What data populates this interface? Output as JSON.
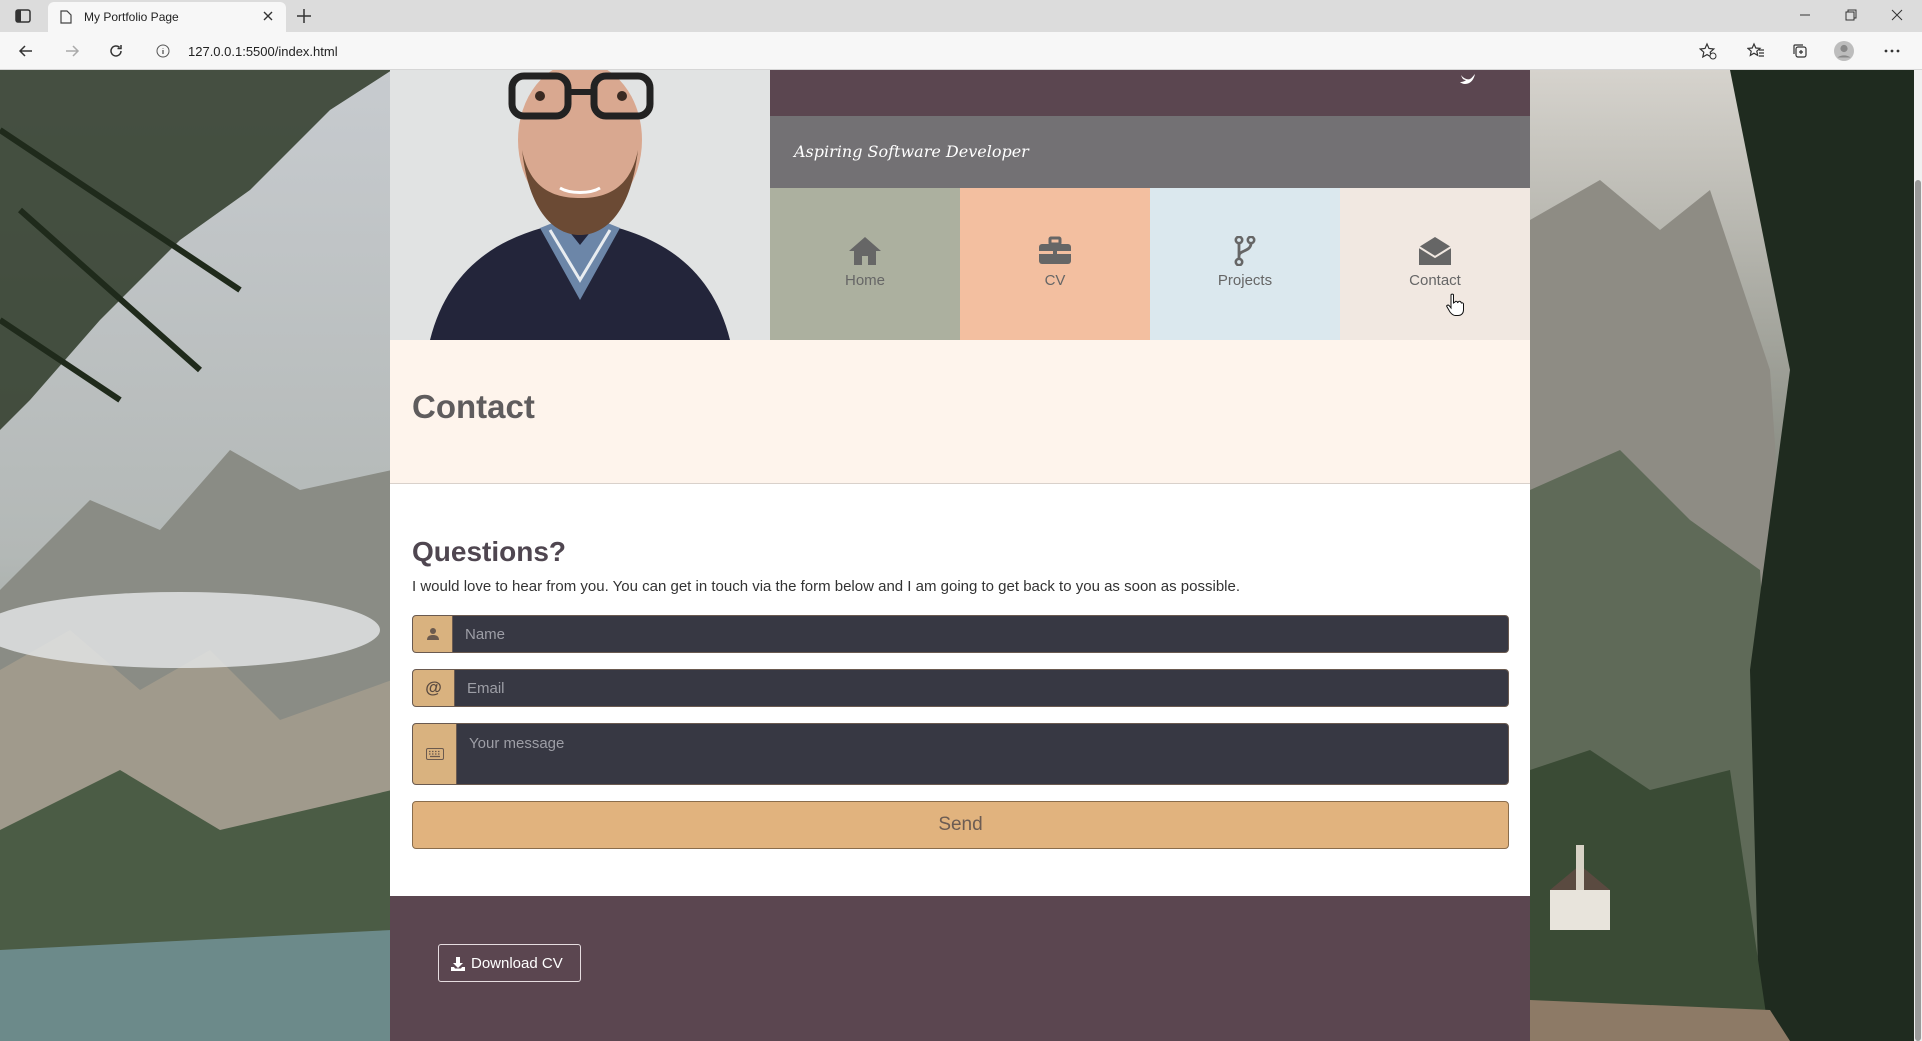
{
  "browser": {
    "tab_title": "My Portfolio Page",
    "url": "127.0.0.1:5500/index.html"
  },
  "hero": {
    "subtitle": "Aspiring Software Developer"
  },
  "nav": {
    "items": [
      {
        "label": "Home",
        "icon": "home-icon"
      },
      {
        "label": "CV",
        "icon": "briefcase-icon"
      },
      {
        "label": "Projects",
        "icon": "code-fork-icon"
      },
      {
        "label": "Contact",
        "icon": "envelope-open-icon"
      }
    ],
    "active": "Contact"
  },
  "section": {
    "title": "Contact"
  },
  "contact": {
    "heading": "Questions?",
    "intro": "I would love to hear from you. You can get in touch via the form below and I am going to get back to you as soon as possible.",
    "name_placeholder": "Name",
    "email_addon": "@",
    "email_placeholder": "Email",
    "message_placeholder": "Your message",
    "send_label": "Send"
  },
  "footer": {
    "download_label": "Download CV"
  },
  "colors": {
    "brand_dark": "#5b4650",
    "accent_gold": "#e1b37e",
    "nav_home": "#acb09f",
    "nav_cv": "#f3bfa0",
    "nav_projects": "#dbe8ee",
    "nav_contact": "#f1e8e1"
  }
}
